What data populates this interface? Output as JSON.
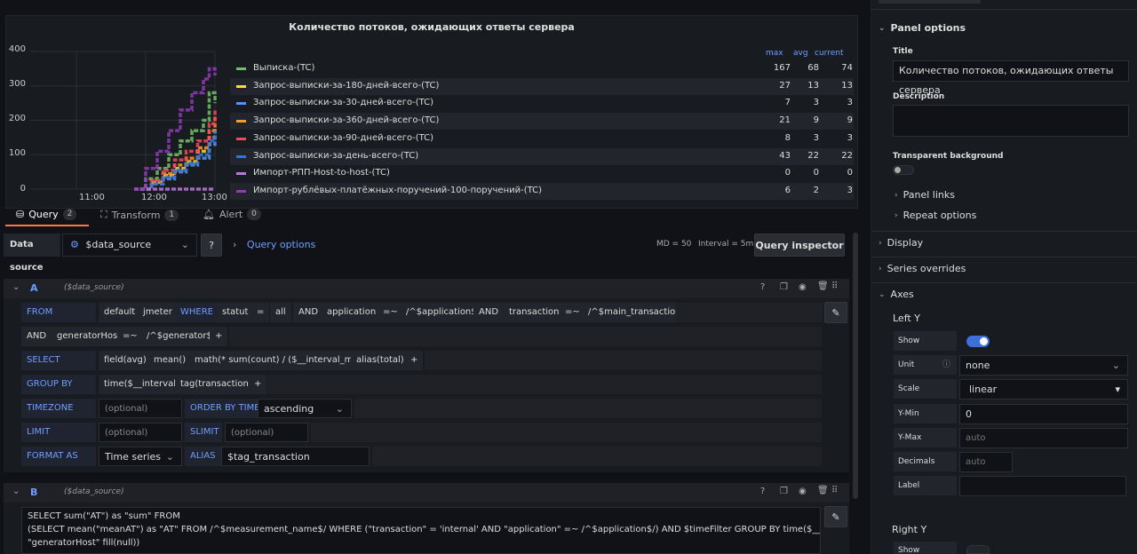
{
  "panel": {
    "title": "Количество потоков, ожидающих ответы сервера",
    "legend_headers": {
      "max": "max",
      "avg": "avg",
      "current": "current"
    }
  },
  "chart_data": {
    "type": "line",
    "title": "Количество потоков, ожидающих ответы сервера",
    "y_ticks": [
      "400",
      "300",
      "200",
      "100",
      "0"
    ],
    "x_ticks": [
      "11:00",
      "12:00",
      "13:00"
    ],
    "ylim": [
      0,
      400
    ],
    "xlim": [
      "10:20",
      "13:00"
    ],
    "grid": true,
    "legend_placement": "right",
    "series": [
      {
        "name": "Выписка-(TC)",
        "color": "#73bf69",
        "max": "167",
        "avg": "68",
        "current": "74",
        "x": [
          "11:50",
          "12:00",
          "12:10",
          "12:20",
          "12:30",
          "12:40",
          "12:50",
          "12:55",
          "13:00"
        ],
        "y": [
          0,
          30,
          60,
          100,
          140,
          170,
          200,
          280,
          250
        ]
      },
      {
        "name": "Запрос-выписки-за-180-дней-всего-(TC)",
        "color": "#fade2a",
        "max": "27",
        "avg": "13",
        "current": "13",
        "x": [
          "11:55",
          "12:05",
          "12:15",
          "12:25",
          "12:35",
          "12:45",
          "12:55",
          "13:00"
        ],
        "y": [
          0,
          20,
          40,
          60,
          80,
          110,
          150,
          180
        ]
      },
      {
        "name": "Запрос-выписки-за-30-дней-всего-(TC)",
        "color": "#5794f2",
        "max": "7",
        "avg": "3",
        "current": "3",
        "x": [
          "11:55",
          "12:05",
          "12:15",
          "12:25",
          "12:35",
          "12:45",
          "12:55",
          "13:00"
        ],
        "y": [
          0,
          15,
          30,
          50,
          70,
          90,
          130,
          160
        ]
      },
      {
        "name": "Запрос-выписки-за-360-дней-всего-(TC)",
        "color": "#ff9830",
        "max": "21",
        "avg": "9",
        "current": "9",
        "x": [
          "11:55",
          "12:05",
          "12:15",
          "12:25",
          "12:35",
          "12:45",
          "12:55",
          "13:00"
        ],
        "y": [
          0,
          20,
          45,
          70,
          90,
          120,
          170,
          210
        ]
      },
      {
        "name": "Запрос-выписки-за-90-дней-всего-(TC)",
        "color": "#f2495c",
        "max": "8",
        "avg": "3",
        "current": "3",
        "x": [
          "11:55",
          "12:05",
          "12:15",
          "12:25",
          "12:35",
          "12:45",
          "12:55",
          "13:00"
        ],
        "y": [
          0,
          25,
          55,
          85,
          110,
          140,
          190,
          230
        ]
      },
      {
        "name": "Запрос-выписки-за-день-всего-(TC)",
        "color": "#3274d9",
        "max": "43",
        "avg": "22",
        "current": "22",
        "x": [
          "11:55",
          "12:05",
          "12:15",
          "12:25",
          "12:35",
          "12:45",
          "12:55",
          "13:00"
        ],
        "y": [
          0,
          15,
          35,
          55,
          75,
          100,
          140,
          170
        ]
      },
      {
        "name": "Импорт-РПП-Host-to-host-(TC)",
        "color": "#b877d9",
        "max": "0",
        "avg": "0",
        "current": "0",
        "x": [
          "11:50",
          "13:00"
        ],
        "y": [
          0,
          0
        ]
      },
      {
        "name": "Импорт-рублёвых-платёжных-поручений-100-поручений-(TC)",
        "color": "#8f3bb8",
        "max": "6",
        "avg": "2",
        "current": "3",
        "x": [
          "11:50",
          "12:00",
          "12:10",
          "12:20",
          "12:30",
          "12:40",
          "12:50",
          "12:55",
          "13:00"
        ],
        "y": [
          0,
          60,
          110,
          170,
          230,
          280,
          320,
          350,
          330
        ]
      }
    ]
  },
  "tabs": [
    {
      "label": "Query",
      "count": "2"
    },
    {
      "label": "Transform",
      "count": "1"
    },
    {
      "label": "Alert",
      "count": "0"
    }
  ],
  "toolbar": {
    "datasource_label": "Data source",
    "datasource_value": "$data_source",
    "query_options": "Query options",
    "md": "MD = 50",
    "interval": "Interval = 5m",
    "inspector": "Query inspector"
  },
  "query_a": {
    "letter": "A",
    "ds": "($data_source)",
    "from_kw": "FROM",
    "from_policy": "default",
    "from_meas": "jmeter",
    "where_kw": "WHERE",
    "w1": "statut",
    "w2": "=",
    "w3": "all",
    "w4": "AND",
    "w5": "application",
    "w6": "=~",
    "w7": "/^$application$/",
    "w8": "AND",
    "w9": "transaction",
    "w10": "=~",
    "w11": "/^$main_transaction$/",
    "w12": "AND",
    "w13": "generatorHost",
    "w14": "=~",
    "w15": "/^$generator$/",
    "plus": "+",
    "select_kw": "SELECT",
    "s1": "field(avg)",
    "s2": "mean()",
    "s3": "math(* sum(count) / ($__interval_ms))",
    "s4": "alias(total)",
    "group_kw": "GROUP BY",
    "g1": "time($__interval)",
    "g2": "tag(transaction)",
    "tz_kw": "TIMEZONE",
    "tz_ph": "(optional)",
    "order_kw": "ORDER BY TIME",
    "order_val": "ascending",
    "limit_kw": "LIMIT",
    "limit_ph": "(optional)",
    "slimit_kw": "SLIMIT",
    "slimit_ph": "(optional)",
    "format_kw": "FORMAT AS",
    "format_val": "Time series",
    "alias_kw": "ALIAS",
    "alias_val": "$tag_transaction"
  },
  "query_b": {
    "letter": "B",
    "ds": "($data_source)",
    "l1": "SELECT sum(\"AT\") as \"sum\" FROM",
    "l2": "(SELECT mean(\"meanAT\") as \"AT\" FROM /^$measurement_name$/ WHERE (\"transaction\" = 'internal' AND \"application\" =~ /^$application$/) AND $timeFilter GROUP BY time($__interval),",
    "l3": "\"generatorHost\" fill(null))"
  },
  "options": {
    "panel_options": "Panel options",
    "title_label": "Title",
    "title_value": "Количество потоков, ожидающих ответы сервера",
    "description_label": "Description",
    "transparent_label": "Transparent background",
    "panel_links": "Panel links",
    "repeat_options": "Repeat options",
    "display": "Display",
    "series_overrides": "Series overrides",
    "axes": "Axes",
    "left_y": "Left Y",
    "show": "Show",
    "unit": "Unit",
    "unit_value": "none",
    "scale": "Scale",
    "scale_value": "linear",
    "ymin": "Y-Min",
    "ymin_value": "0",
    "ymax": "Y-Max",
    "ymax_ph": "auto",
    "decimals": "Decimals",
    "decimals_ph": "auto",
    "label": "Label",
    "right_y": "Right Y",
    "show2": "Show"
  }
}
